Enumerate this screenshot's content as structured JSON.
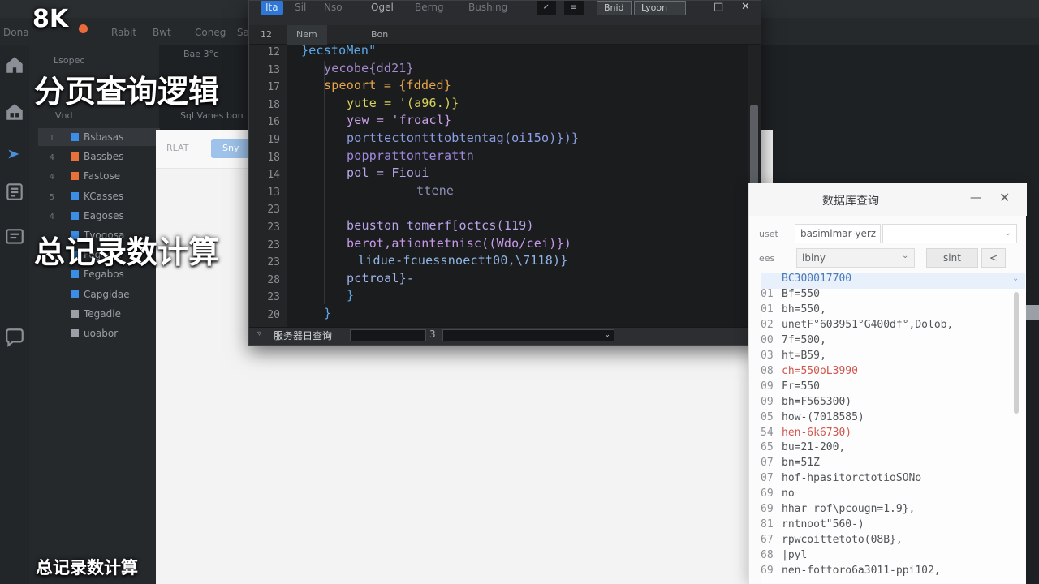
{
  "overlay": {
    "badge": "8K",
    "heading1": "分页查询逻辑",
    "heading2": "总记录数计算",
    "footer": "总记录数计算"
  },
  "colors": {
    "ide_bg": "#1e2124",
    "editor_bg": "#1b1c1e",
    "accent_blue": "#2f77d6",
    "orange": "#e86b3a",
    "dialog_bg": "#fbfbfb"
  },
  "background_ide": {
    "tabs": [
      "Dona",
      "Rabit",
      "Bwt",
      "Coneg",
      "Sa"
    ],
    "sidebar_header": "Lsopec",
    "sidebar_subtitle": "Bae 3°c",
    "sidebar_path": "Vnd",
    "sidebar_path2": "Sql Vanes bon",
    "activity_icons": [
      "home-icon",
      "store-icon",
      "debug-icon",
      "clipboard-icon",
      "terminal-icon",
      "chat-icon"
    ],
    "sidebar_items": [
      {
        "num": "1",
        "label": "Bsbasas",
        "color": "#3a8ee6"
      },
      {
        "num": "4",
        "label": "Bassbes",
        "color": "#e8713a"
      },
      {
        "num": "4",
        "label": "Fastose",
        "color": "#e8713a"
      },
      {
        "num": "5",
        "label": "KCasses",
        "color": "#3a8ee6"
      },
      {
        "num": "4",
        "label": "Eagoses",
        "color": "#3a8ee6"
      },
      {
        "num": "",
        "label": "Tvogosa",
        "color": "#3a8ee6"
      },
      {
        "num": "",
        "label": "Fegadie",
        "color": "#3a8ee6"
      },
      {
        "num": "",
        "label": "Fegabos",
        "color": "#3a8ee6"
      },
      {
        "num": "",
        "label": "Capgidae",
        "color": "#3a8ee6"
      },
      {
        "num": "",
        "label": "Tegadie",
        "color": "#9aa0a6"
      },
      {
        "num": "",
        "label": "uoabor",
        "color": "#9aa0a6"
      }
    ]
  },
  "background_panel": {
    "btn1": "RLAT",
    "btn2": "Sny"
  },
  "editor": {
    "tabs": [
      "Ita",
      "Sil",
      "Nso",
      "Ogel",
      "Berng",
      "Bushing"
    ],
    "toolbar_btn1": "✓",
    "toolbar_btn2": "≡",
    "window_btn1": "Bnid",
    "window_btn2": "Lyoon",
    "minimize": "□",
    "close": "✕",
    "subbar_ln": "12",
    "subbar_tab1": "Nem",
    "subbar_tab2": "Bon",
    "line_numbers": [
      "12",
      "13",
      "17",
      "18",
      "16",
      "19",
      "18",
      "14",
      "13",
      "23",
      "23",
      "23",
      "23",
      "28",
      "23",
      "20"
    ],
    "code_lines": [
      {
        "text": "}ecstoMen\"",
        "color": "#5fa8e8"
      },
      {
        "text": "yecobe{dd21}",
        "color": "#a78bd0"
      },
      {
        "text": "speoort = {fdded}",
        "color": "#e6a34a"
      },
      {
        "text": "yute = '(a96.)}",
        "color": "#d8d35a"
      },
      {
        "text": "yew = 'froacl}",
        "color": "#c7a0e6"
      },
      {
        "text": "porttectontttobtentag(oi15o)})}",
        "color": "#8c9fe6"
      },
      {
        "text": "popprattonterattn",
        "color": "#a08ae0"
      },
      {
        "text": "pol = Fioui",
        "color": "#b8a6ea"
      },
      {
        "text": "ttene",
        "color": "#8c8fb4"
      },
      {
        "text": "",
        "color": "#8c8fb4"
      },
      {
        "text": "beuston tomerf[octcs(119)",
        "color": "#b9a3ea"
      },
      {
        "text": "berot,ationtetnisc((Wdo/cei)})",
        "color": "#c79ae8"
      },
      {
        "text": "lidue-fcuessnoectt00,\\7118)}",
        "color": "#8fb5e6"
      },
      {
        "text": "pctroal}-",
        "color": "#9fb4ee"
      },
      {
        "text": "}",
        "color": "#5fa8e8"
      },
      {
        "text": "}",
        "color": "#5fa8e8"
      }
    ],
    "status_label": "服务器日查询",
    "status_sep": "3",
    "status_dropdown": "⌄"
  },
  "dialog": {
    "title": "数据库查询",
    "minimize": "—",
    "close": "✕",
    "label1": "uset",
    "input1": "basimlmar yerz",
    "input2": "",
    "label2": "ees",
    "input3": "lbiny",
    "run_button": "sint",
    "prev_button": "<",
    "rows": [
      {
        "n": "",
        "text": "BC300017700",
        "cls": "blue"
      },
      {
        "n": "01",
        "text": "Bf=550",
        "cls": ""
      },
      {
        "n": "01",
        "text": "bh=550,",
        "cls": ""
      },
      {
        "n": "02",
        "text": "unetF°603951°G400df°,Dolob,",
        "cls": ""
      },
      {
        "n": "00",
        "text": "7f=500,",
        "cls": ""
      },
      {
        "n": "03",
        "text": "ht=B59,",
        "cls": ""
      },
      {
        "n": "08",
        "text": "ch=550oL3990",
        "cls": "red"
      },
      {
        "n": "09",
        "text": "Fr=550",
        "cls": ""
      },
      {
        "n": "09",
        "text": "bh=F565300)",
        "cls": ""
      },
      {
        "n": "05",
        "text": "how-(7018585)",
        "cls": ""
      },
      {
        "n": "54",
        "text": "hen-6k6730)",
        "cls": "red"
      },
      {
        "n": "65",
        "text": "bu=21-200,",
        "cls": ""
      },
      {
        "n": "07",
        "text": "bn=51Z",
        "cls": ""
      },
      {
        "n": "07",
        "text": "hof-hpasitorctotioSONo",
        "cls": ""
      },
      {
        "n": "69",
        "text": "no",
        "cls": ""
      },
      {
        "n": "69",
        "text": "hhar rof\\pcougn=1.9},",
        "cls": ""
      },
      {
        "n": "81",
        "text": "rntnoot\"560-)",
        "cls": ""
      },
      {
        "n": "67",
        "text": "rpwcoittetoto(08B},",
        "cls": ""
      },
      {
        "n": "68",
        "text": "|pyl",
        "cls": ""
      },
      {
        "n": "69",
        "text": "nen-fottoro6a3011-ppi102,",
        "cls": ""
      }
    ]
  }
}
